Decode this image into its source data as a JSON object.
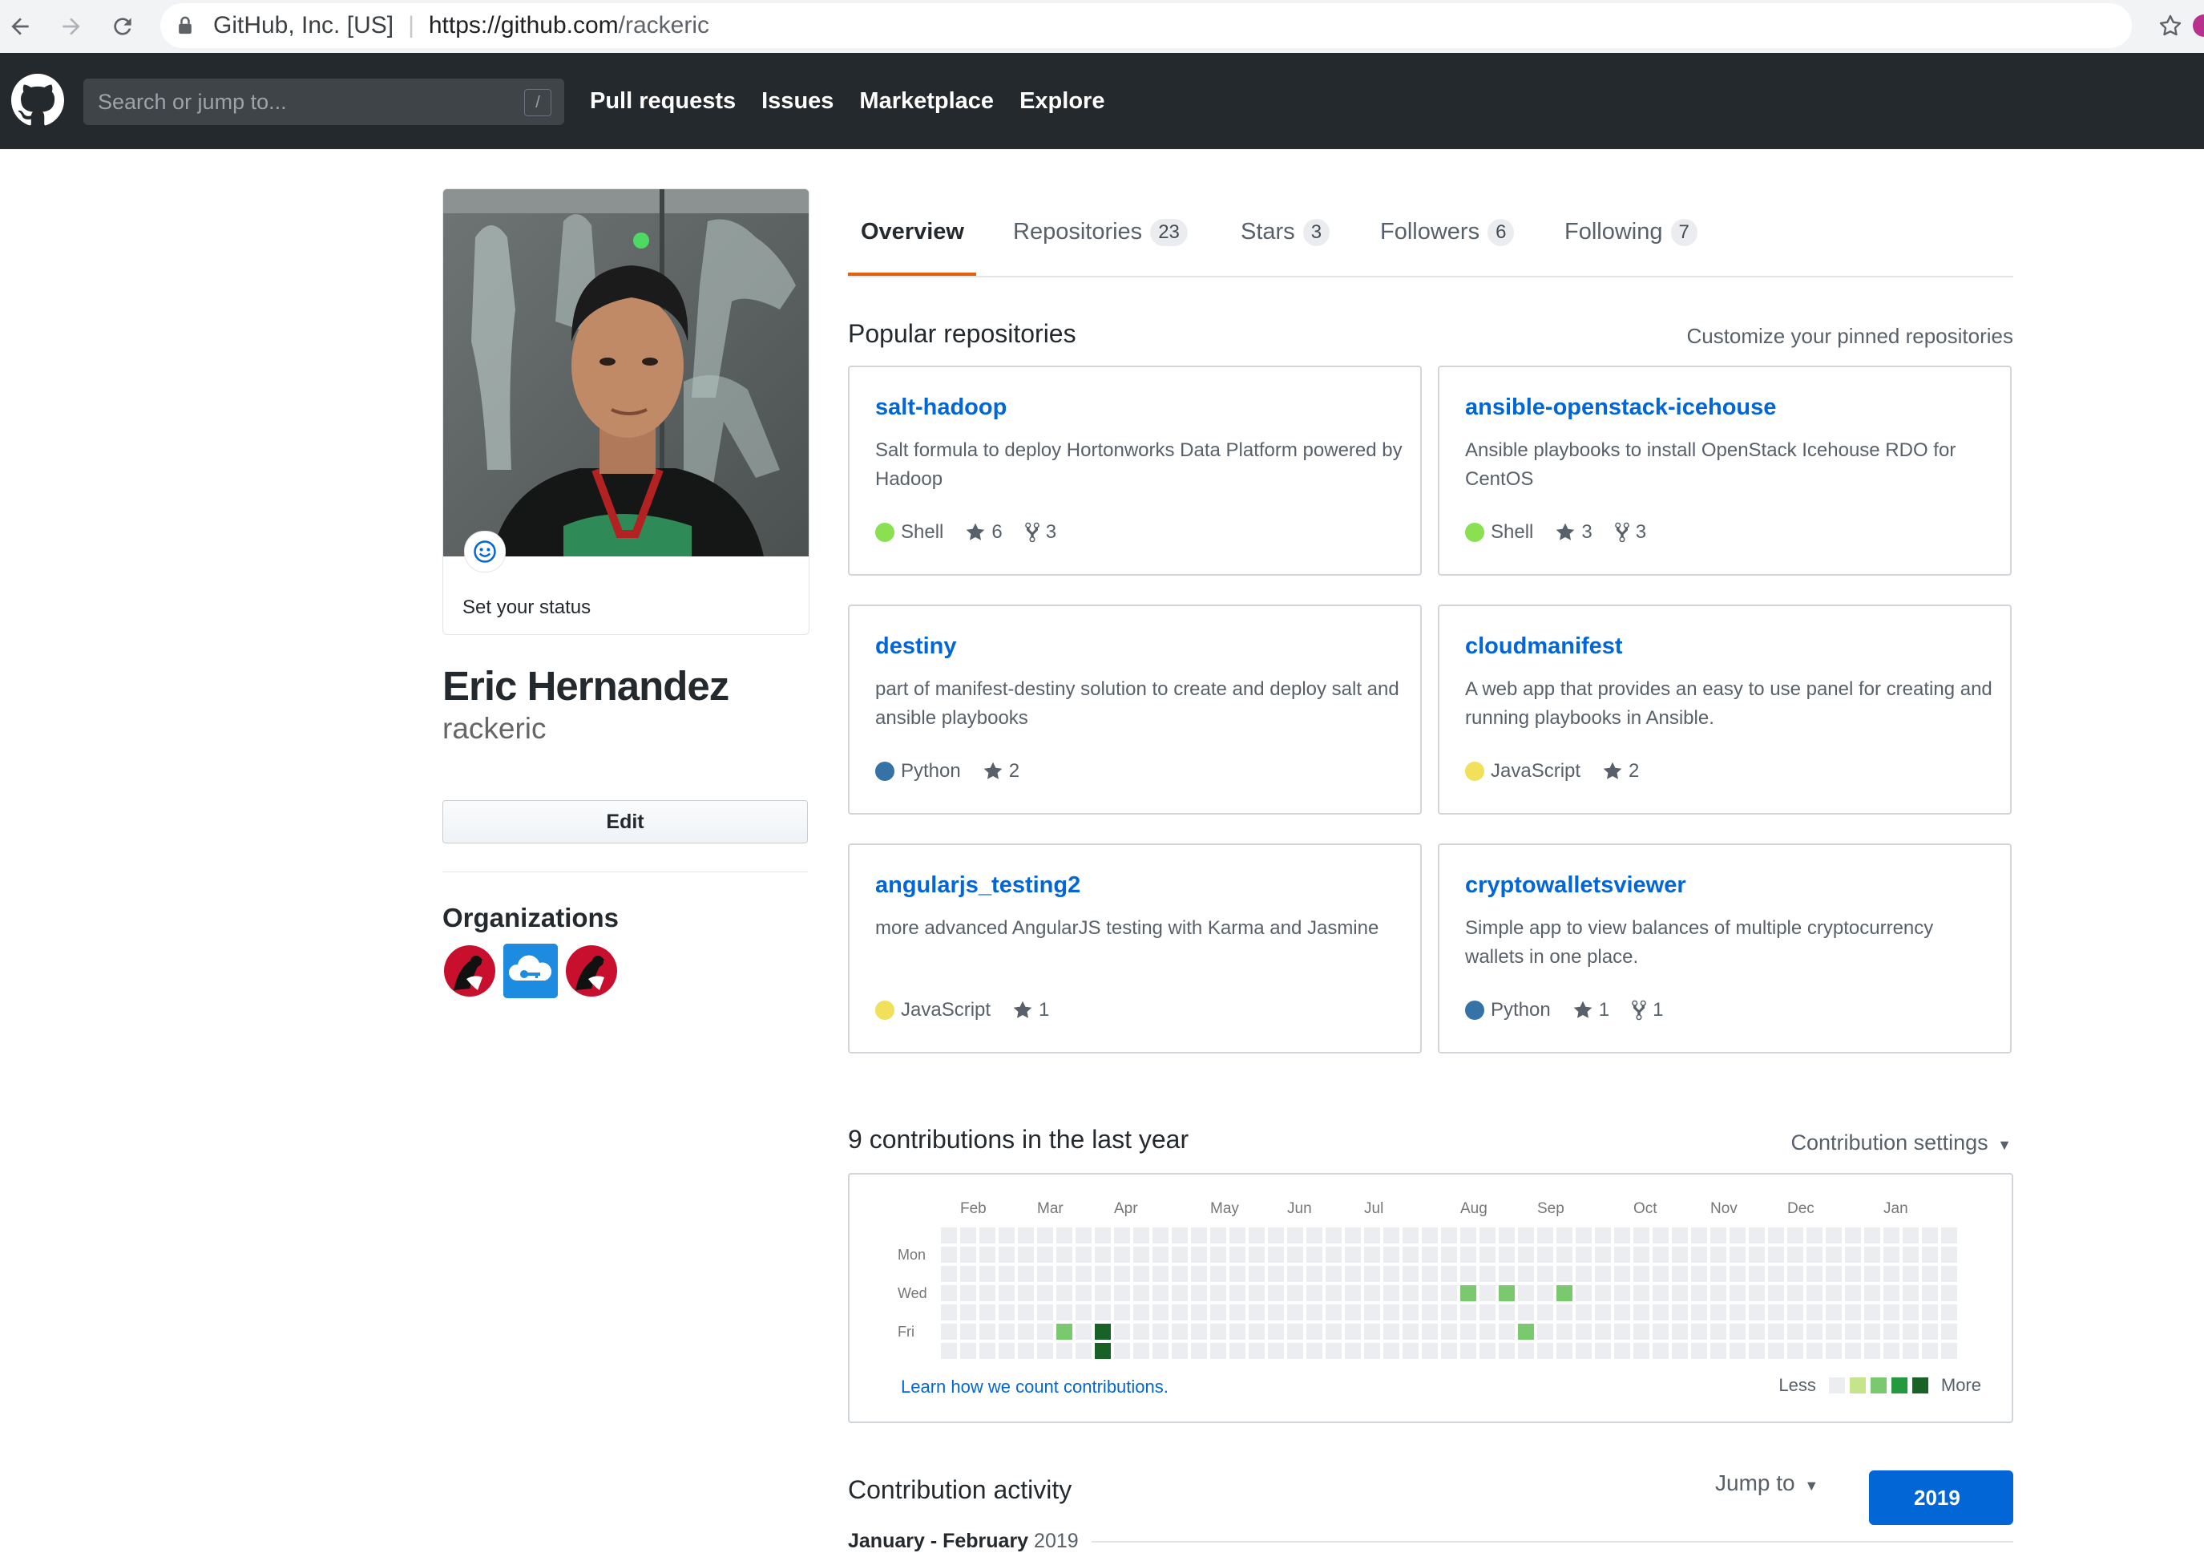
{
  "browser": {
    "org": "GitHub, Inc. [US]",
    "host": "https://github.com",
    "path": "/rackeric"
  },
  "header": {
    "search_placeholder": "Search or jump to...",
    "slash_key": "/",
    "nav": [
      "Pull requests",
      "Issues",
      "Marketplace",
      "Explore"
    ]
  },
  "profile": {
    "status": "Set your status",
    "name": "Eric Hernandez",
    "login": "rackeric",
    "edit_label": "Edit",
    "organizations_title": "Organizations",
    "organizations": [
      "rackspace-icon",
      "cloud-key-icon",
      "rackspace-icon"
    ]
  },
  "tabs": [
    {
      "label": "Overview",
      "count": null,
      "selected": true
    },
    {
      "label": "Repositories",
      "count": "23"
    },
    {
      "label": "Stars",
      "count": "3"
    },
    {
      "label": "Followers",
      "count": "6"
    },
    {
      "label": "Following",
      "count": "7"
    }
  ],
  "pinned": {
    "title": "Popular repositories",
    "customize": "Customize your pinned repositories",
    "repos": [
      {
        "name": "salt-hadoop",
        "desc": "Salt formula to deploy Hortonworks Data Platform powered by Hadoop",
        "lang": "Shell",
        "lang_color": "#89e051",
        "stars": "6",
        "forks": "3"
      },
      {
        "name": "ansible-openstack-icehouse",
        "desc": "Ansible playbooks to install OpenStack Icehouse RDO for CentOS",
        "lang": "Shell",
        "lang_color": "#89e051",
        "stars": "3",
        "forks": "3"
      },
      {
        "name": "destiny",
        "desc": "part of manifest-destiny solution to create and deploy salt and ansible playbooks",
        "lang": "Python",
        "lang_color": "#3572A5",
        "stars": "2",
        "forks": null
      },
      {
        "name": "cloudmanifest",
        "desc": "A web app that provides an easy to use panel for creating and running playbooks in Ansible.",
        "lang": "JavaScript",
        "lang_color": "#f1e05a",
        "stars": "2",
        "forks": null
      },
      {
        "name": "angularjs_testing2",
        "desc": "more advanced AngularJS testing with Karma and Jasmine",
        "lang": "JavaScript",
        "lang_color": "#f1e05a",
        "stars": "1",
        "forks": null
      },
      {
        "name": "cryptowalletsviewer",
        "desc": "Simple app to view balances of multiple cryptocurrency wallets in one place.",
        "lang": "Python",
        "lang_color": "#3572A5",
        "stars": "1",
        "forks": "1"
      }
    ]
  },
  "contributions": {
    "title": "9 contributions in the last year",
    "settings": "Contribution settings",
    "months": [
      "Feb",
      "Mar",
      "Apr",
      "May",
      "Jun",
      "Jul",
      "Aug",
      "Sep",
      "Oct",
      "Nov",
      "Dec",
      "Jan"
    ],
    "month_week_index": [
      1,
      5,
      9,
      14,
      18,
      22,
      27,
      31,
      36,
      40,
      44,
      49
    ],
    "days": [
      "Mon",
      "Wed",
      "Fri"
    ],
    "weeks": 53,
    "levels_palette": [
      "#ebedf0",
      "#c6e48b",
      "#7bc96f",
      "#239a3b",
      "#196127"
    ],
    "cells": [
      {
        "week": 6,
        "day": 5,
        "level": 2
      },
      {
        "week": 8,
        "day": 5,
        "level": 4
      },
      {
        "week": 8,
        "day": 6,
        "level": 4
      },
      {
        "week": 27,
        "day": 3,
        "level": 2
      },
      {
        "week": 29,
        "day": 3,
        "level": 2
      },
      {
        "week": 30,
        "day": 5,
        "level": 2
      },
      {
        "week": 32,
        "day": 3,
        "level": 2
      }
    ],
    "learn_link": "Learn how we count contributions.",
    "legend_less": "Less",
    "legend_more": "More"
  },
  "activity": {
    "title": "Contribution activity",
    "jump_to": "Jump to",
    "year": "2019",
    "month_label": "January - February",
    "month_year": "2019"
  }
}
